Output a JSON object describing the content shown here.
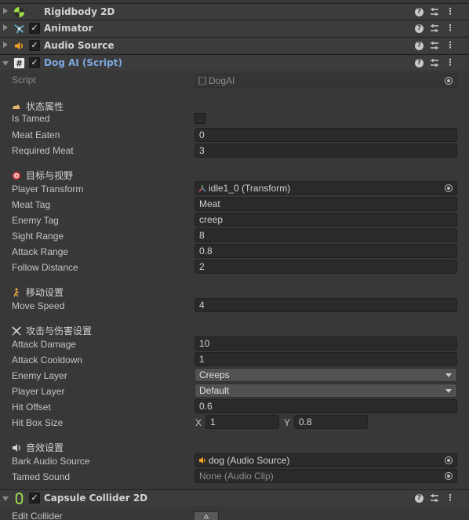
{
  "components": [
    {
      "title": "Rigidbody 2D",
      "icon": "rigidbody-2d-icon",
      "expanded": false,
      "has_toggle": false
    },
    {
      "title": "Animator",
      "icon": "animator-icon",
      "expanded": false,
      "has_toggle": true,
      "enabled": true
    },
    {
      "title": "Audio Source",
      "icon": "audio-source-icon",
      "expanded": false,
      "has_toggle": true,
      "enabled": true
    },
    {
      "title": "Dog AI (Script)",
      "icon": "script-icon",
      "expanded": true,
      "has_toggle": true,
      "enabled": true
    },
    {
      "title": "Capsule Collider 2D",
      "icon": "capsule-collider-icon",
      "expanded": true,
      "has_toggle": true,
      "enabled": true
    }
  ],
  "header_buttons": {
    "help": "?",
    "more": "⋮"
  },
  "checkmark": "✓",
  "script": {
    "label": "Script",
    "value": "DogAI"
  },
  "sections": {
    "state": {
      "title": "状态属性",
      "icon": "cat-icon"
    },
    "target": {
      "title": "目标与视野",
      "icon": "target-icon"
    },
    "move": {
      "title": "移动设置",
      "icon": "walking-icon"
    },
    "attack": {
      "title": "攻击与伤害设置",
      "icon": "crossed-swords-icon"
    },
    "audio": {
      "title": "音效设置",
      "icon": "speaker-icon"
    }
  },
  "fields": {
    "is_tamed": {
      "label": "Is Tamed",
      "value": false
    },
    "meat_eaten": {
      "label": "Meat Eaten",
      "value": "0"
    },
    "required_meat": {
      "label": "Required Meat",
      "value": "3"
    },
    "player_transform": {
      "label": "Player Transform",
      "value": "idle1_0 (Transform)"
    },
    "meat_tag": {
      "label": "Meat Tag",
      "value": "Meat"
    },
    "enemy_tag": {
      "label": "Enemy Tag",
      "value": "creep"
    },
    "sight_range": {
      "label": "Sight Range",
      "value": "8"
    },
    "attack_range": {
      "label": "Attack Range",
      "value": "0.8"
    },
    "follow_distance": {
      "label": "Follow Distance",
      "value": "2"
    },
    "move_speed": {
      "label": "Move Speed",
      "value": "4"
    },
    "attack_damage": {
      "label": "Attack Damage",
      "value": "10"
    },
    "attack_cooldown": {
      "label": "Attack Cooldown",
      "value": "1"
    },
    "enemy_layer": {
      "label": "Enemy Layer",
      "value": "Creeps"
    },
    "player_layer": {
      "label": "Player Layer",
      "value": "Default"
    },
    "hit_offset": {
      "label": "Hit Offset",
      "value": "0.6"
    },
    "hit_box_size": {
      "label": "Hit Box Size",
      "x_label": "X",
      "x": "1",
      "y_label": "Y",
      "y": "0.8"
    },
    "bark_audio_source": {
      "label": "Bark Audio Source",
      "value": "dog (Audio Source)"
    },
    "tamed_sound": {
      "label": "Tamed Sound",
      "value": "None (Audio Clip)"
    }
  },
  "collider": {
    "edit_label": "Edit Collider"
  },
  "colors": {
    "background": "#383838",
    "header": "#3c3c3c",
    "field": "#2a2a2a",
    "script_title": "#7fa7e0"
  }
}
